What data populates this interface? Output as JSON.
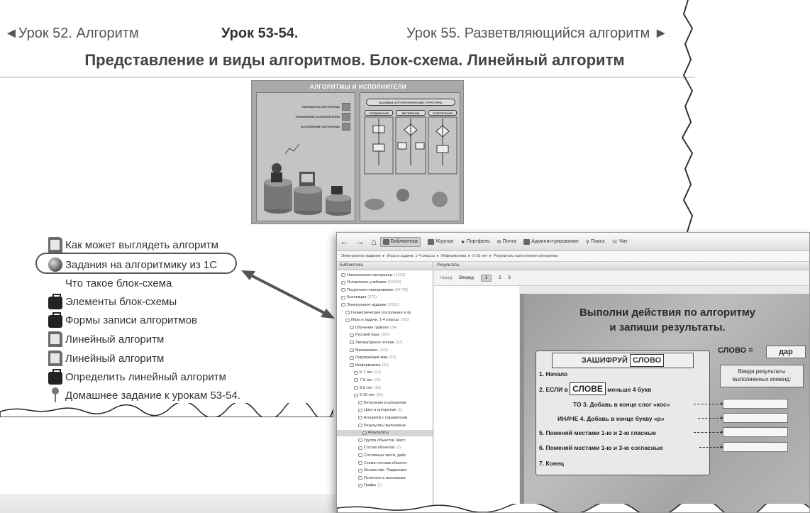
{
  "nav": {
    "prev": "◄Урок 52. Алгоритм",
    "current": "Урок 53-54.",
    "next": "Урок 55. Разветвляющийся алгоритм ►"
  },
  "lesson_title": "Представление и виды алгоритмов. Блок-схема. Линейный алгоритм",
  "poster": {
    "title": "АЛГОРИТМЫ И ИСПОЛНИТЕЛИ",
    "left_items": [
      "РАЗРАБОТКА АЛГОРИТМА",
      "УПРАВЛЕНИЕ ИСПОЛНИТЕЛЕМ",
      "ИСПОЛНЕНИЕ АЛГОРИТМА"
    ],
    "structures_title": "БАЗОВЫЕ АЛГОРИТМИЧЕСКИЕ СТРУКТУРЫ",
    "structures": [
      "СЛЕДОВАНИЕ",
      "ВЕТВЛЕНИЕ",
      "ПОВТОРЕНИЕ"
    ]
  },
  "menu": [
    {
      "label": "Как может выглядеть алгоритм",
      "icon": "book-icon"
    },
    {
      "label": "Задания на алгоритмику из 1С",
      "icon": "globe-icon"
    },
    {
      "label": "Что такое блок-схема",
      "icon": "page-icon"
    },
    {
      "label": "Элементы блок-схемы",
      "icon": "briefcase-icon"
    },
    {
      "label": "Формы записи алгоритмов",
      "icon": "briefcase-icon"
    },
    {
      "label": "Линейный алгоритм",
      "icon": "book-icon"
    },
    {
      "label": "Линейный алгоритм",
      "icon": "book-icon"
    },
    {
      "label": "Определить линейный алгоритм",
      "icon": "briefcase-icon"
    },
    {
      "label": "Домашнее задание к урокам 53-54.",
      "icon": "pin-icon"
    }
  ],
  "app": {
    "toolbar": [
      "Библиотека",
      "Журнал",
      "Портфель",
      "Почта",
      "Администрирование",
      "Поиск",
      "Чат"
    ],
    "breadcrumbs": [
      "Электронное издание",
      "Игры и задачи, 1-4 классы",
      "Информатика",
      "9-10 лет",
      "Результаты выполнения алгоритма"
    ],
    "tree_title": "Библиотека",
    "results_title": "Результаты",
    "pager": {
      "back": "Назад",
      "forward": "Вперед",
      "pages": [
        "1",
        "2",
        "3"
      ]
    },
    "tree": [
      {
        "label": "Назначенные материалы",
        "count": "(1222)"
      },
      {
        "label": "Оглавление учебника",
        "count": "(62900)"
      },
      {
        "label": "Поурочное планирование",
        "count": "(24725)"
      },
      {
        "label": "Коллекция",
        "count": "(373)"
      },
      {
        "label": "Электронное издание",
        "count": "(2652)"
      },
      {
        "label": "Геометрические построения в пр",
        "count": ""
      },
      {
        "label": "Игры и задачи, 1-4 классы",
        "count": "(760)"
      },
      {
        "label": "Обучение грамоте",
        "count": "(34)"
      },
      {
        "label": "Русский язык",
        "count": "(125)"
      },
      {
        "label": "Литературное чтение",
        "count": "(97)"
      },
      {
        "label": "Математика",
        "count": "(165)"
      },
      {
        "label": "Окружающий мир",
        "count": "(93)"
      },
      {
        "label": "Информатика",
        "count": "(93)"
      },
      {
        "label": "6-7 лет",
        "count": "(24)"
      },
      {
        "label": "7-8 лет",
        "count": "(21)"
      },
      {
        "label": "8-9 лет",
        "count": "(18)"
      },
      {
        "label": "9-10 лет",
        "count": "(19)"
      },
      {
        "label": "Ветвление в алгоритме",
        "count": ""
      },
      {
        "label": "Цикл в алгоритме",
        "count": "(1)"
      },
      {
        "label": "Алгоритм с параметрам",
        "count": ""
      },
      {
        "label": "Результаты выполнени",
        "count": ""
      },
      {
        "label": "Результаты",
        "count": ""
      },
      {
        "label": "Группа объектов. Масс",
        "count": ""
      },
      {
        "label": "Состав объектов",
        "count": "(2)"
      },
      {
        "label": "Составные части, дейс",
        "count": ""
      },
      {
        "label": "Схема состава объекта",
        "count": ""
      },
      {
        "label": "Множество. Подмножес",
        "count": ""
      },
      {
        "label": "Истинность высказыва",
        "count": ""
      },
      {
        "label": "Графы",
        "count": "(1)"
      }
    ]
  },
  "exercise": {
    "title_line1": "Выполни действия по алгоритму",
    "title_line2": "и запиши результаты.",
    "header_prefix": "ЗАШИФРУЙ",
    "header_word": "СЛОВО",
    "steps": {
      "s1": "1. Начало",
      "s2_prefix": "2. ЕСЛИ в",
      "s2_word": "СЛОВЕ",
      "s2_suffix": "меньше 4 букв",
      "s3": "ТО  3. Добавь в конце слог «кос»",
      "s4": "ИНАЧЕ  4. Добавь в конце букву «р»",
      "s5": "5. Поменяй местами 1-ю и 2-ю гласные",
      "s6": "6. Поменяй местами 1-ю и 3-ю согласные",
      "s7": "7. Конец"
    },
    "word_label": "СЛОВО =",
    "word_value": "дар",
    "results_label": "Введи результаты выполненных команд:"
  }
}
